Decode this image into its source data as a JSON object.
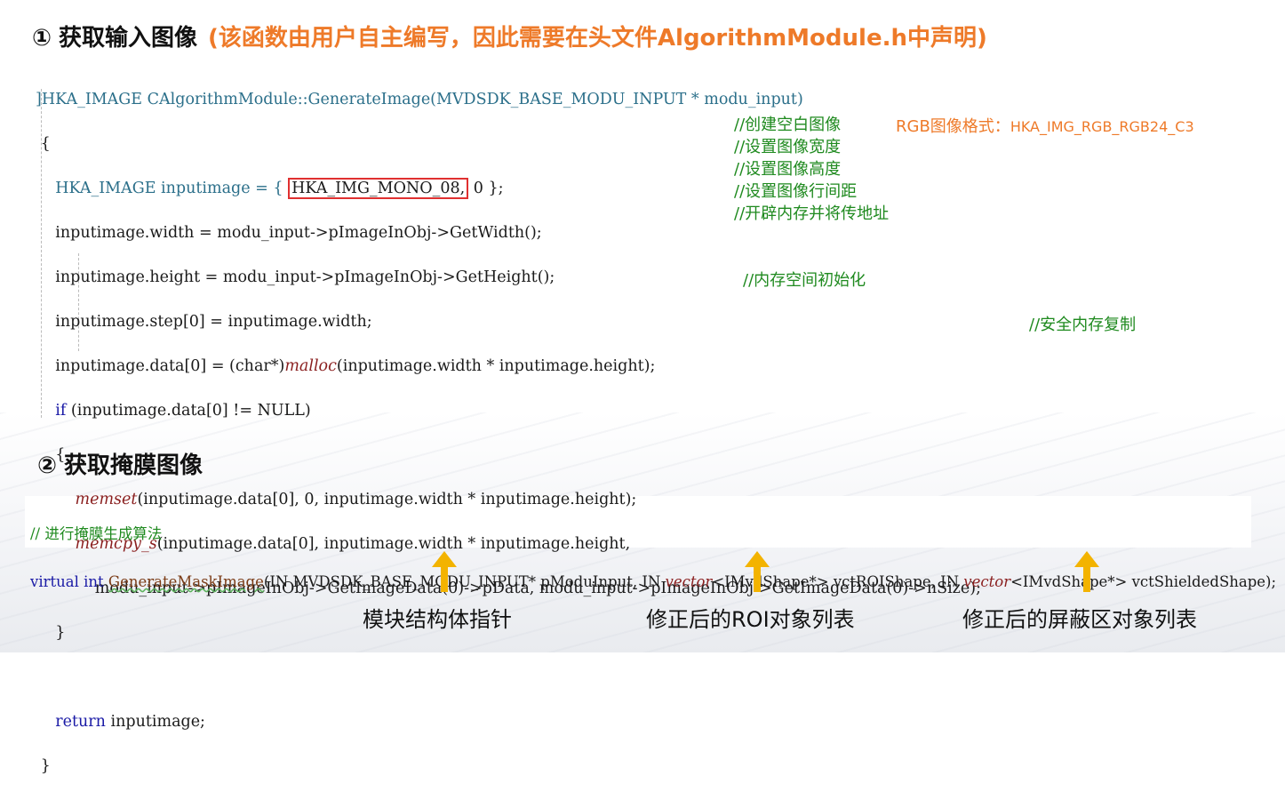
{
  "section1": {
    "number": "①",
    "title": "获取输入图像",
    "note": "(该函数由用户自主编写，因此需要在头文件AlgorithmModule.h中声明)"
  },
  "section2": {
    "number": "②",
    "title": "获取掩膜图像"
  },
  "rgb_note": {
    "label": "RGB图像格式：",
    "value": "HKA_IMG_RGB_RGB24_C3"
  },
  "code1": {
    "line1": "]HKA_IMAGE CAlgorithmModule::GenerateImage(MVDSDK_BASE_MODU_INPUT * modu_input)",
    "line2": " {",
    "line3_pre": "    HKA_IMAGE inputimage = { ",
    "line3_box": "HKA_IMG_MONO_08,",
    "line3_post": " 0 };",
    "line4": "    inputimage.width = modu_input->pImageInObj->GetWidth();",
    "line5": "    inputimage.height = modu_input->pImageInObj->GetHeight();",
    "line6": "    inputimage.step[0] = inputimage.width;",
    "line7_pre": "    inputimage.data[0] = (char*)",
    "line7_fn": "malloc",
    "line7_post": "(inputimage.width * inputimage.height);",
    "line8_kw": "if",
    "line8_rest": " (inputimage.data[0] != NULL)",
    "line9": "    {",
    "line10_fn": "memset",
    "line10_rest": "(inputimage.data[0], 0, inputimage.width * inputimage.height);  ",
    "line11_fn": "memcpy_s",
    "line11_rest": "(inputimage.data[0], inputimage.width * inputimage.height,",
    "line12": "            modu_input->pImageInObj->GetImageData(0)->pData, modu_input->pImageInObj->GetImageData(0)->nSize);",
    "line13": "    }",
    "line15_kw": "return",
    "line15_rest": " inputimage;",
    "line16": " }"
  },
  "comments": {
    "c3": "//创建空白图像",
    "c4": "//设置图像宽度",
    "c5": "//设置图像高度",
    "c6": "//设置图像行间距",
    "c7": "//开辟内存并将传地址",
    "c10": "//内存空间初始化",
    "c12": "//安全内存复制"
  },
  "code2": {
    "comment": "// 进行掩膜生成算法",
    "kw_virtual": "virtual",
    "kw_int": "int",
    "fn_name": "GenerateMaskImage",
    "p1": "(IN MVDSDK_BASE_MODU_INPUT* pModuInput, IN ",
    "vector1": "vector",
    "p2": "<IMvdShape*> vctROIShape, IN ",
    "vector2": "vector",
    "p3": "<IMvdShape*> vctShieldedShape);"
  },
  "annotations": [
    {
      "label": "模块结构体指针"
    },
    {
      "label": "修正后的ROI对象列表"
    },
    {
      "label": "修正后的屏蔽区对象列表"
    }
  ],
  "colors": {
    "accent_orange": "#ee7a29",
    "arrow_yellow": "#f3b300",
    "comment_green": "#1f8a1f",
    "box_red": "#e03030"
  }
}
